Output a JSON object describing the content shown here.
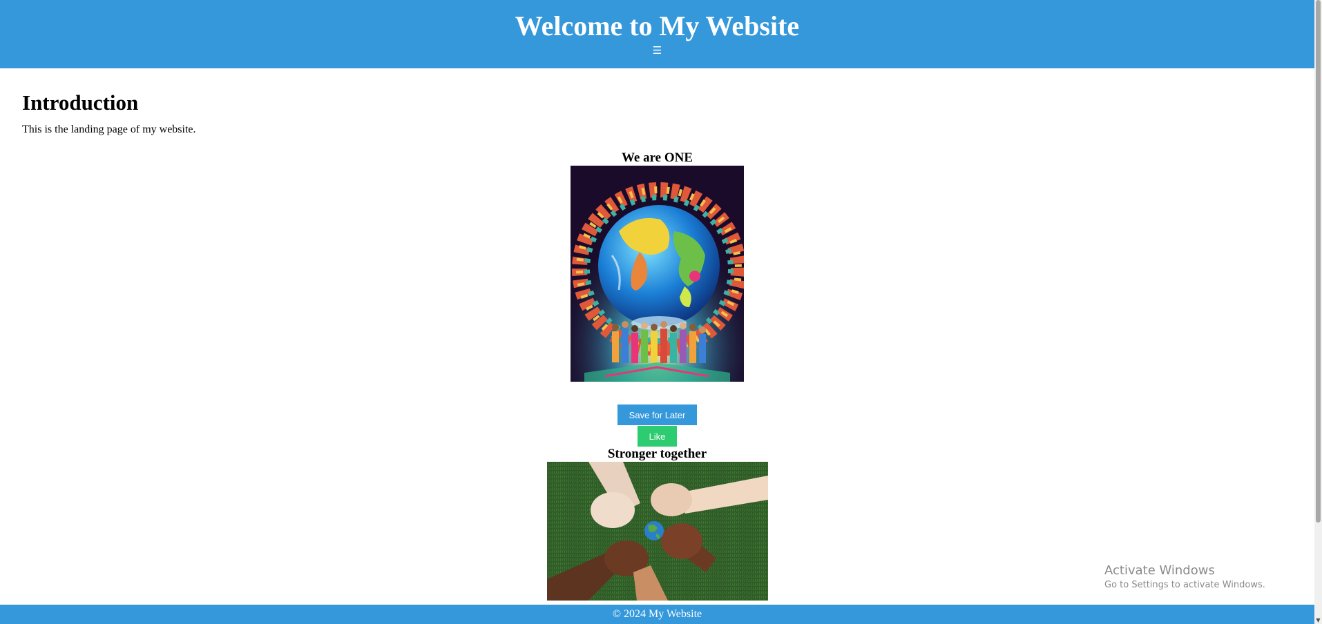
{
  "header": {
    "title": "Welcome to My Website",
    "menu_icon": "☰",
    "background_color": "#3498db"
  },
  "intro": {
    "heading": "Introduction",
    "text": "This is the landing page of my website."
  },
  "gallery": [
    {
      "caption": "We are ONE",
      "image": "globe-with-diverse-people"
    },
    {
      "caption": "Stronger together",
      "image": "interlocked-hands-globe"
    }
  ],
  "buttons": {
    "save_label": "Save for Later",
    "save_color": "#3498db",
    "like_label": "Like",
    "like_color": "#2ecc71"
  },
  "footer": {
    "text": "© 2024 My Website"
  },
  "watermark": {
    "title": "Activate Windows",
    "subtitle": "Go to Settings to activate Windows."
  }
}
